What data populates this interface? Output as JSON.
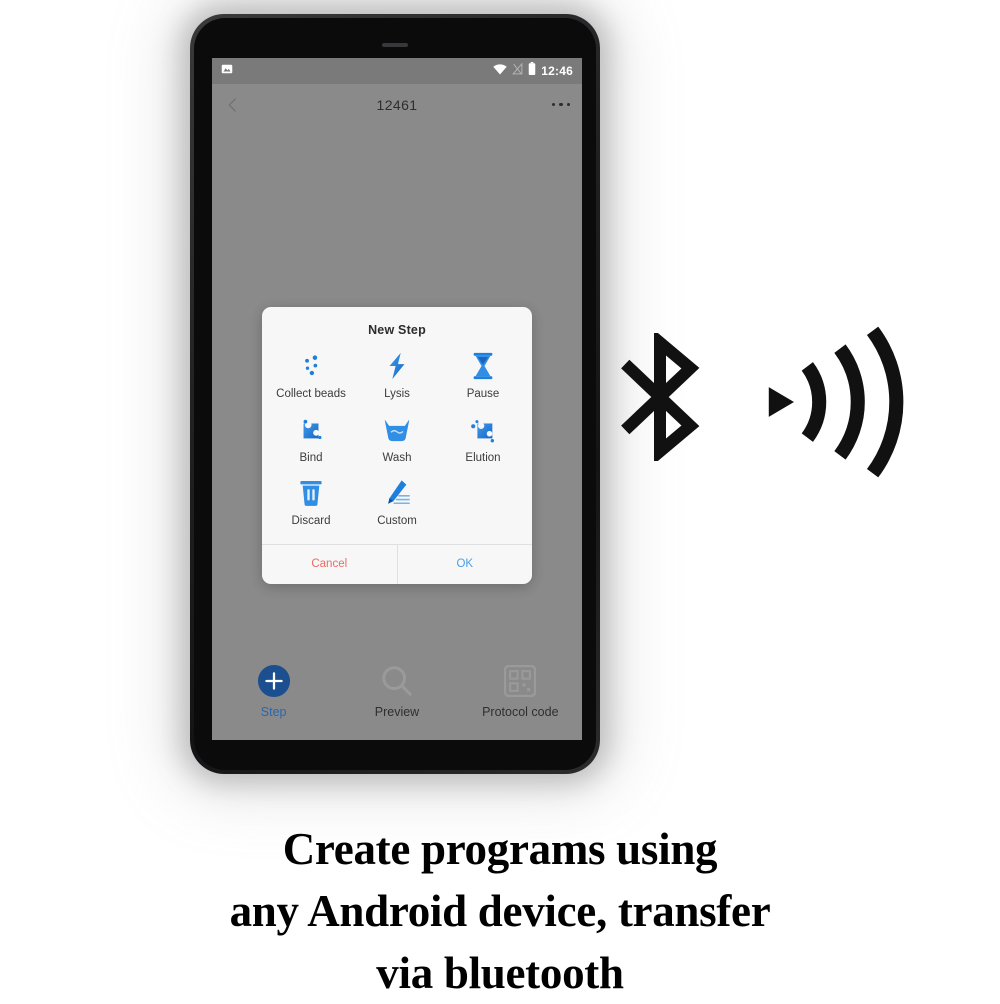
{
  "phone": {
    "status_bar": {
      "notification_icon": "image-notification-icon",
      "wifi_icon": "wifi-icon",
      "signal_off_icon": "signal-off-icon",
      "battery_icon": "battery-icon",
      "clock": "12:46"
    },
    "app_bar": {
      "back_icon": "back-chevron-icon",
      "title": "12461",
      "overflow_icon": "overflow-menu-icon"
    },
    "dialog": {
      "title": "New Step",
      "steps": [
        {
          "label": "Collect beads",
          "icon": "beads-cluster-icon"
        },
        {
          "label": "Lysis",
          "icon": "lightning-bolt-icon"
        },
        {
          "label": "Pause",
          "icon": "hourglass-icon"
        },
        {
          "label": "Bind",
          "icon": "bind-beads-icon"
        },
        {
          "label": "Wash",
          "icon": "wash-basin-icon"
        },
        {
          "label": "Elution",
          "icon": "elution-beads-icon"
        },
        {
          "label": "Discard",
          "icon": "trash-can-icon"
        },
        {
          "label": "Custom",
          "icon": "pencil-edit-icon"
        }
      ],
      "cancel_label": "Cancel",
      "ok_label": "OK"
    },
    "bottom_nav": [
      {
        "label": "Step",
        "icon": "plus-circle-icon",
        "active": true
      },
      {
        "label": "Preview",
        "icon": "magnifier-icon",
        "active": false
      },
      {
        "label": "Protocol code",
        "icon": "qr-code-icon",
        "active": false
      }
    ]
  },
  "side_icons": {
    "bluetooth": "bluetooth-icon",
    "waves": "signal-waves-icon"
  },
  "caption": {
    "line1": "Create programs using",
    "line2": "any Android device, transfer",
    "line3": "via bluetooth"
  },
  "colors": {
    "accent_blue": "#2196F3",
    "nav_active_blue": "#2b66ad",
    "cancel_red": "#ef6a63",
    "ok_blue": "#4a9fe8",
    "screen_gray": "#8a8a8a",
    "status_gray": "#7a7a7a"
  }
}
